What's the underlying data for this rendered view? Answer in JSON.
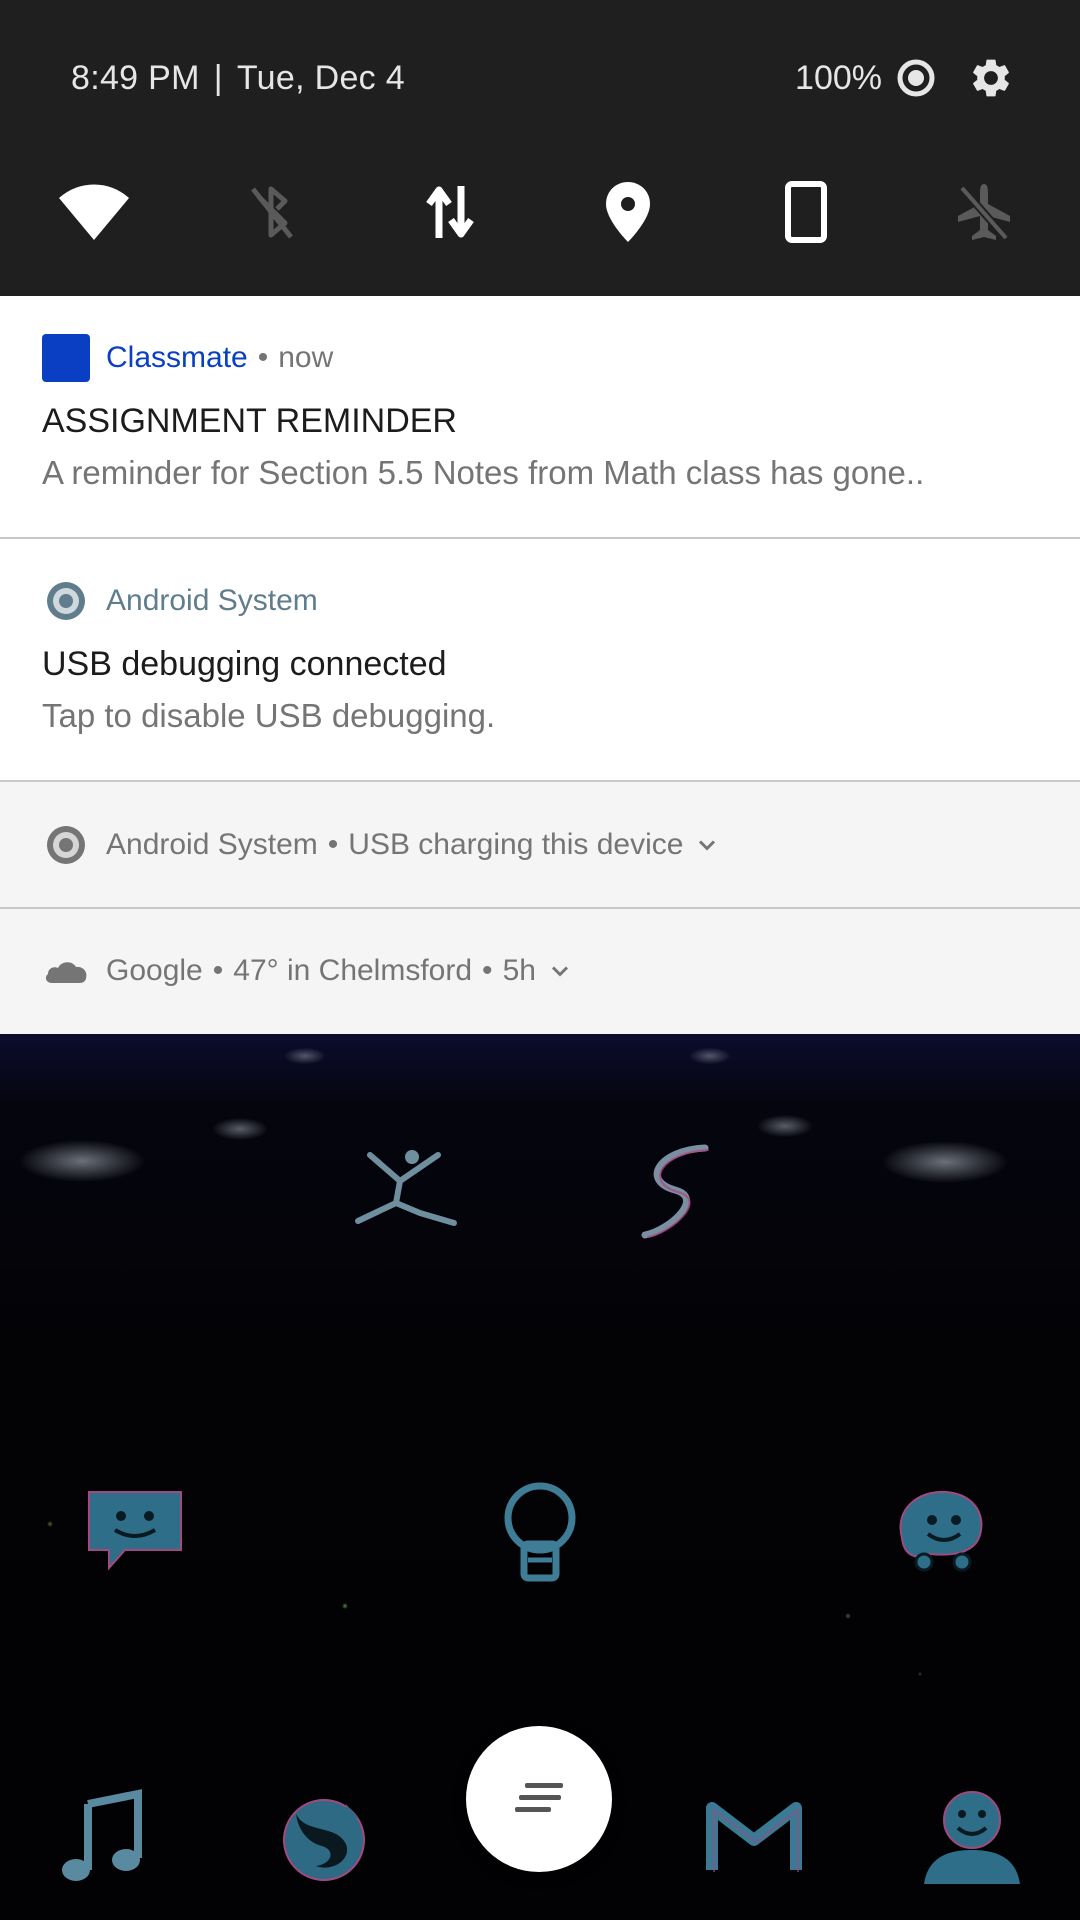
{
  "status": {
    "time": "8:49 PM",
    "separator": "|",
    "date": "Tue, Dec 4",
    "battery": "100%"
  },
  "quick_tiles": [
    {
      "name": "wifi",
      "icon": "wifi-icon",
      "active": true
    },
    {
      "name": "bluetooth",
      "icon": "bluetooth-off-icon",
      "active": false
    },
    {
      "name": "mobile-data",
      "icon": "data-arrows-icon",
      "active": true
    },
    {
      "name": "location",
      "icon": "location-pin-icon",
      "active": true
    },
    {
      "name": "auto-rotate",
      "icon": "phone-portrait-icon",
      "active": true
    },
    {
      "name": "airplane-mode",
      "icon": "airplane-off-icon",
      "active": false
    }
  ],
  "notifications": {
    "classmate": {
      "app": "Classmate",
      "separator": "•",
      "time": "now",
      "title": "ASSIGNMENT REMINDER",
      "text": "A reminder for Section 5.5 Notes from Math class has gone..",
      "app_color": "#0a3fc4"
    },
    "usb_debug": {
      "app": "Android System",
      "title": "USB debugging connected",
      "text": "Tap to disable USB debugging.",
      "app_color": "#5f7d8c"
    },
    "usb_charging": {
      "app": "Android System",
      "separator": "•",
      "summary": "USB charging this device"
    },
    "google_weather": {
      "app": "Google",
      "separator": "•",
      "summary": "47° in Chelmsford",
      "separator2": "•",
      "time": "5h"
    }
  },
  "colors": {
    "quick_settings_bg": "#1f1f1f",
    "classmate_blue": "#0a3fc4",
    "android_teal": "#5f7d8c",
    "text_primary": "#1c1c1c",
    "text_secondary": "#757575"
  },
  "home_icons": [
    {
      "name": "dancer-app-icon"
    },
    {
      "name": "s-logo-app-icon"
    },
    {
      "name": "messaging-app-icon"
    },
    {
      "name": "lightbulb-app-icon"
    },
    {
      "name": "waze-app-icon"
    },
    {
      "name": "music-app-icon"
    },
    {
      "name": "firefox-app-icon"
    },
    {
      "name": "app-drawer-icon"
    },
    {
      "name": "gmail-app-icon"
    },
    {
      "name": "contacts-app-icon"
    }
  ]
}
